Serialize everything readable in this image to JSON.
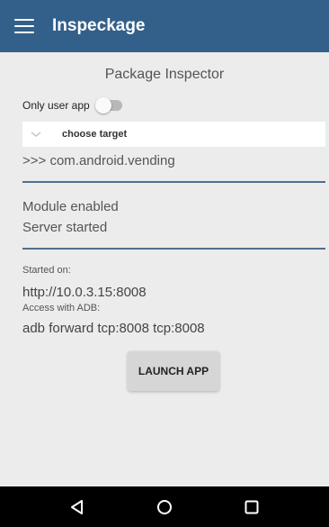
{
  "app": {
    "title": "Inspeckage"
  },
  "main": {
    "heading": "Package Inspector",
    "toggle": {
      "label": "Only user app",
      "checked": false
    },
    "spinner": {
      "selected": "choose target"
    },
    "target": ">>> com.android.vending",
    "status": {
      "module": "Module enabled",
      "server": "Server started"
    },
    "server_info": {
      "started_label": "Started on:",
      "url": "http://10.0.3.15:8008",
      "adb_label": "Access with ADB:",
      "adb_command": "adb forward tcp:8008 tcp:8008"
    },
    "launch_button": "LAUNCH APP"
  },
  "navbar": {
    "icons": [
      "back-icon",
      "home-icon",
      "recents-icon"
    ]
  },
  "colors": {
    "appbar": "#33608a",
    "divider": "#4f6f8f",
    "background": "#ececec"
  }
}
